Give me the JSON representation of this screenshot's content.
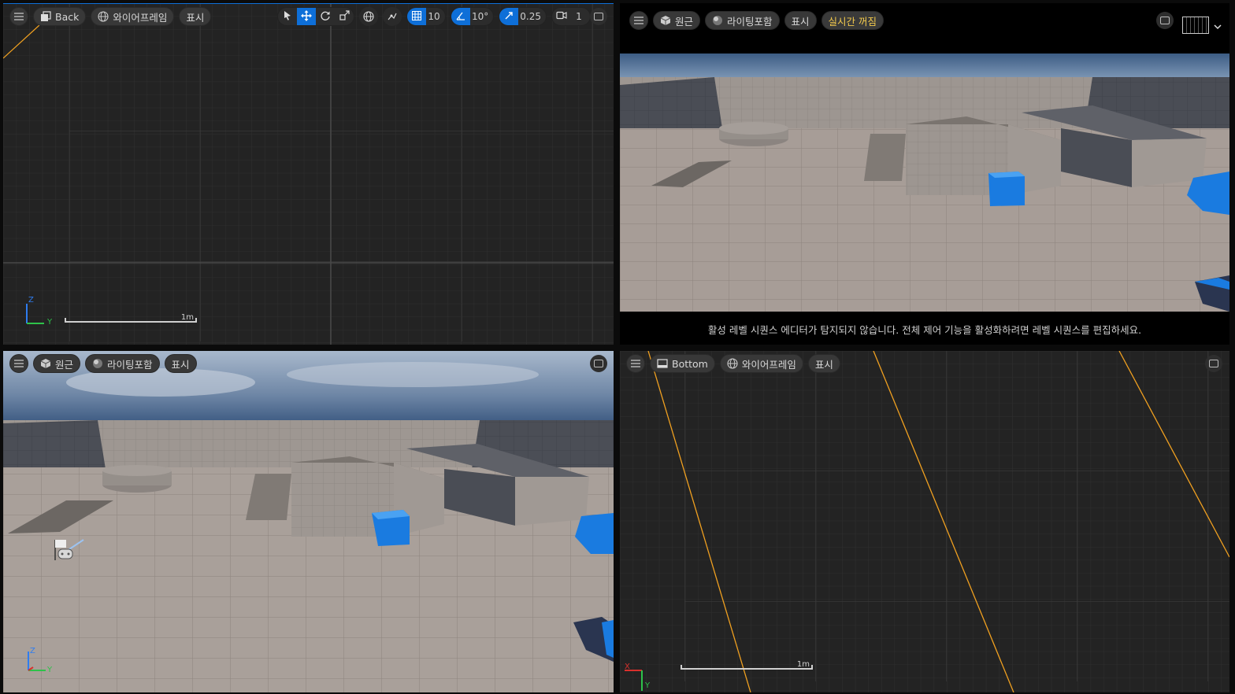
{
  "viewport_back": {
    "view_label": "Back",
    "mode_label": "와이어프레임",
    "show_label": "표시",
    "grid_snap_value": "10",
    "rotate_snap_value": "10°",
    "scale_snap_value": "0.25",
    "camera_speed_value": "1",
    "scale_label": "1m",
    "axis_z": "Z",
    "axis_y": "Y"
  },
  "viewport_perspective_main": {
    "view_label": "원근",
    "lighting_label": "라이팅포함",
    "show_label": "표시",
    "realtime_label": "실시간 꺼짐",
    "message": "활성 레벨 시퀀스 에디터가 탐지되지 않습니다. 전체 제어 기능을 활성화하려면 레벨 시퀀스를 편집하세요."
  },
  "viewport_perspective_bottom": {
    "view_label": "원근",
    "lighting_label": "라이팅포함",
    "show_label": "표시",
    "axis_z": "Z",
    "axis_y": "Y"
  },
  "viewport_bottom": {
    "view_label": "Bottom",
    "mode_label": "와이어프레임",
    "show_label": "표시",
    "scale_label": "1m",
    "axis_x": "X",
    "axis_y": "Y"
  },
  "colors": {
    "accent": "#0e6fd8",
    "wire_orange": "#f0a020",
    "realtime_yellow": "#f2c94c"
  }
}
